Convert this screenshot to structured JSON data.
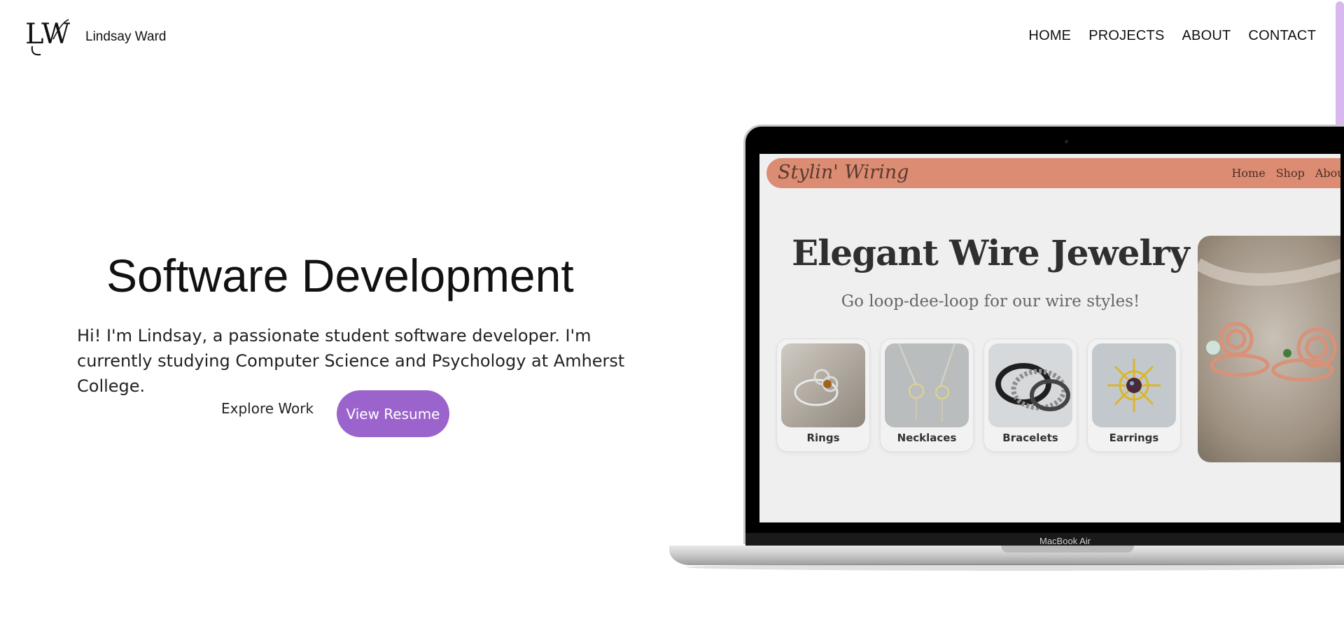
{
  "header": {
    "logo_text": "LW",
    "site_name": "Lindsay Ward",
    "nav": [
      {
        "label": "HOME"
      },
      {
        "label": "PROJECTS"
      },
      {
        "label": "ABOUT"
      },
      {
        "label": "CONTACT"
      }
    ]
  },
  "hero": {
    "title": "Software Development",
    "intro": "Hi! I'm Lindsay, a passionate student software developer. I'm currently studying Computer Science and Psychology at Amherst College.",
    "explore_label": "Explore Work",
    "resume_label": "View Resume",
    "accent_color": "#9b63cc"
  },
  "mockup": {
    "device_label": "MacBook Air",
    "brand": "Stylin' Wiring",
    "nav": [
      "Home",
      "Shop",
      "About"
    ],
    "title": "Elegant Wire Jewelry",
    "subtitle": "Go loop-dee-loop for our wire styles!",
    "nav_color": "#db8c73",
    "categories": [
      {
        "label": "Rings"
      },
      {
        "label": "Necklaces"
      },
      {
        "label": "Bracelets"
      },
      {
        "label": "Earrings"
      }
    ]
  }
}
